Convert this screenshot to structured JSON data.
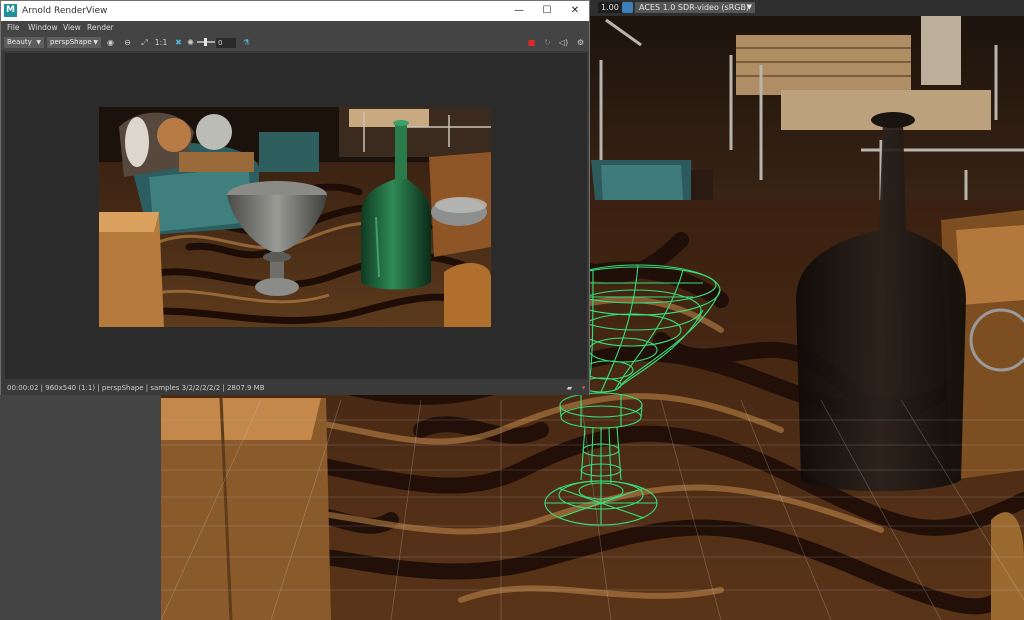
{
  "window": {
    "title": "Arnold RenderView",
    "app_icon_letter": "M",
    "minimize": "—",
    "maximize": "☐",
    "close": "✕"
  },
  "menu": {
    "items": [
      "File",
      "Window",
      "View",
      "Render"
    ]
  },
  "toolbar": {
    "aov": "Beauty",
    "camera": "perspShape",
    "ratio_label": "1:1",
    "exposure_value": "0"
  },
  "status": {
    "text": "00:00:02  |  960x540 (1:1)  |  perspShape  |  samples 3/2/2/2/2/2  |  2807.9 MB"
  },
  "viewport": {
    "gamma_value": "1.00",
    "color_space": "ACES 1.0 SDR-video (sRGB)"
  },
  "colors": {
    "wireframe": "#35e07a",
    "carpet_dark": "#2a120a",
    "carpet_light": "#b07a45",
    "accent_blue": "#3d7fb8"
  },
  "icons": [
    "arnold-app-icon",
    "render-region-icon",
    "snapshot-icon",
    "fit-icon",
    "exposure-icon",
    "color-picker-icon",
    "stop-icon",
    "refresh-icon",
    "ipr-icon",
    "settings-icon"
  ]
}
